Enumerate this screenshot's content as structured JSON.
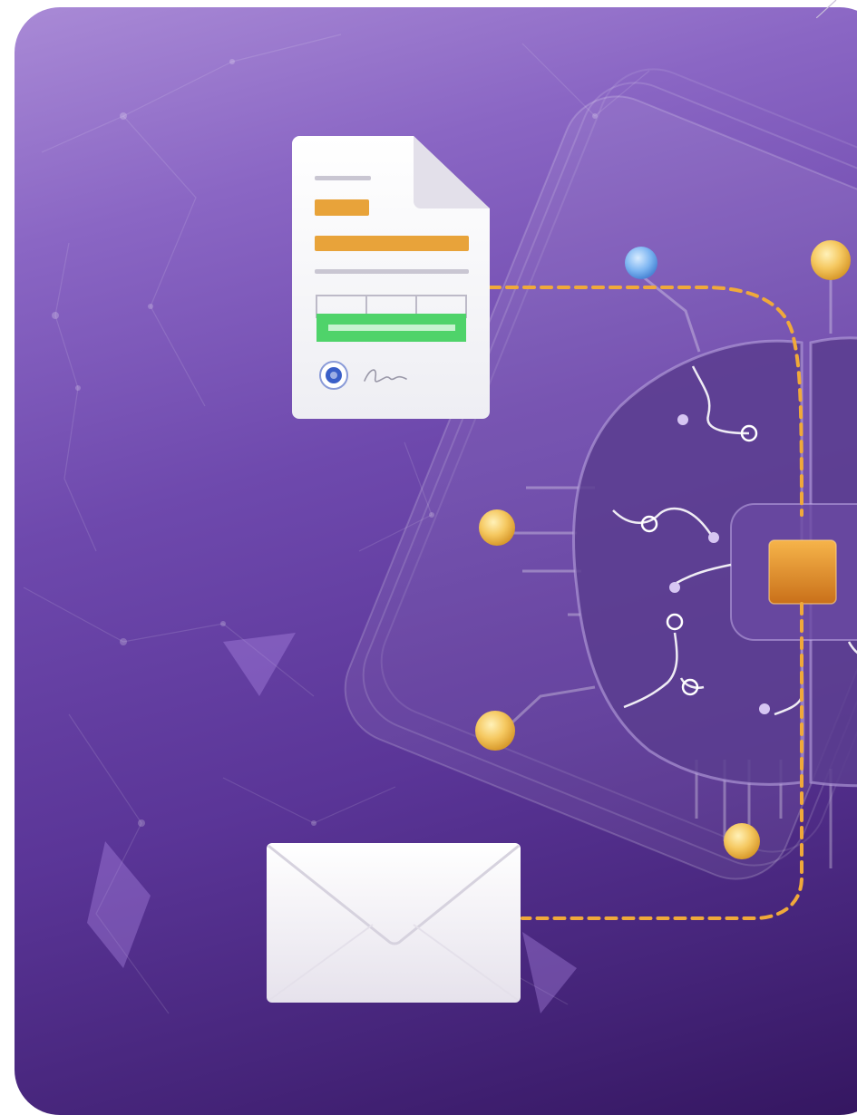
{
  "colors": {
    "background_top": "#a98ad6",
    "background_bottom": "#341660",
    "brain_fill": "#5a3d8f",
    "circuit_line": "#ffffff",
    "connector_dash": "#f0a93a",
    "node_gold": "#f5c860",
    "node_blue": "#7eb6f2",
    "chip": "#e8922a",
    "form_accent_orange": "#e8a33a",
    "form_accent_green": "#4fd36a",
    "radio_blue": "#3a5fc8"
  },
  "icons": {
    "document": "form-document-icon",
    "envelope": "envelope-icon",
    "brain": "ai-brain-icon",
    "chip": "processor-chip-icon",
    "signature": "signature-icon"
  }
}
